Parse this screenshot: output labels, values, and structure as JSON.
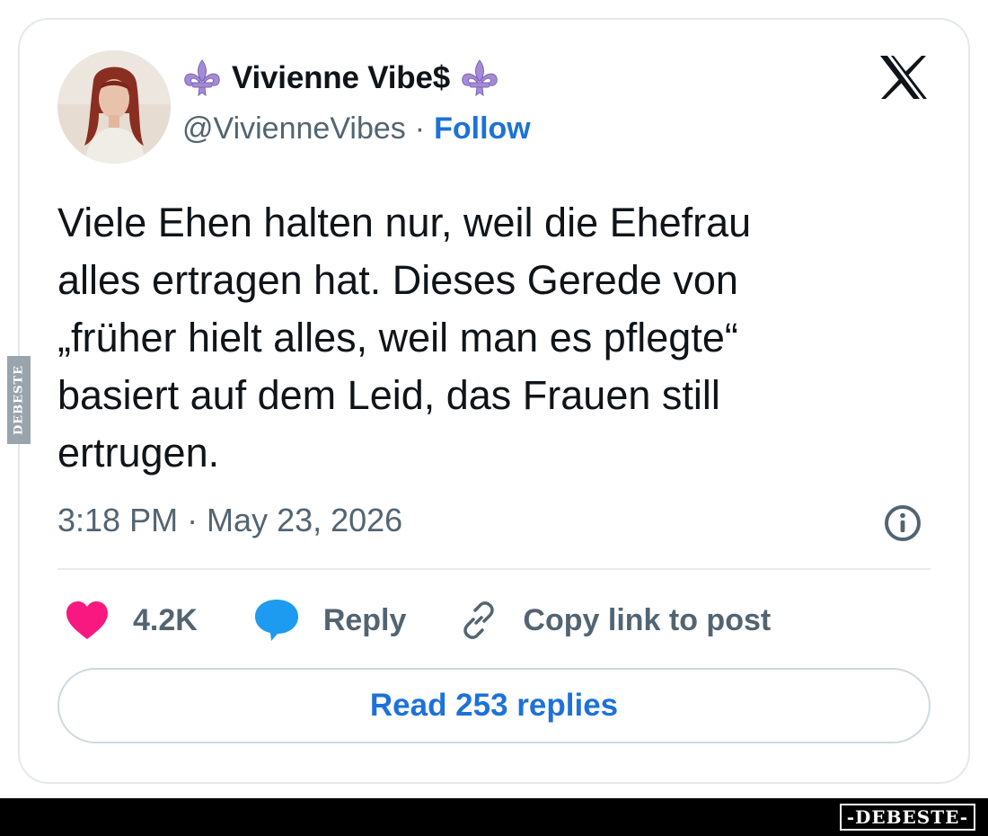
{
  "tweet": {
    "author": {
      "display_name": "Vivienne Vibe$",
      "name_emoji": "fleur-de-lis",
      "handle": "@VivienneVibes",
      "separator": "·",
      "follow_label": "Follow"
    },
    "text": "Viele Ehen halten nur, weil die Ehefrau\nalles ertragen hat. Dieses Gerede von\n„früher hielt alles, weil man es pflegte“\nbasiert auf dem Leid, das Frauen still\nertrugen.",
    "timestamp": "3:18 PM · May 23, 2026",
    "actions": {
      "like_count": "4.2K",
      "reply_label": "Reply",
      "copy_link_label": "Copy link to post"
    },
    "read_replies_label": "Read 253 replies"
  },
  "icons": {
    "platform": "x-logo-icon",
    "info": "info-icon",
    "like": "heart-icon",
    "reply": "speech-bubble-icon",
    "copy_link": "link-icon"
  },
  "colors": {
    "like": "#f91880",
    "reply": "#1d9bf0",
    "link_text": "#1d72d8",
    "fleur": "#a58bd6"
  },
  "watermarks": {
    "side": "DEBESTE",
    "bottom": "-DEBESTE-"
  }
}
